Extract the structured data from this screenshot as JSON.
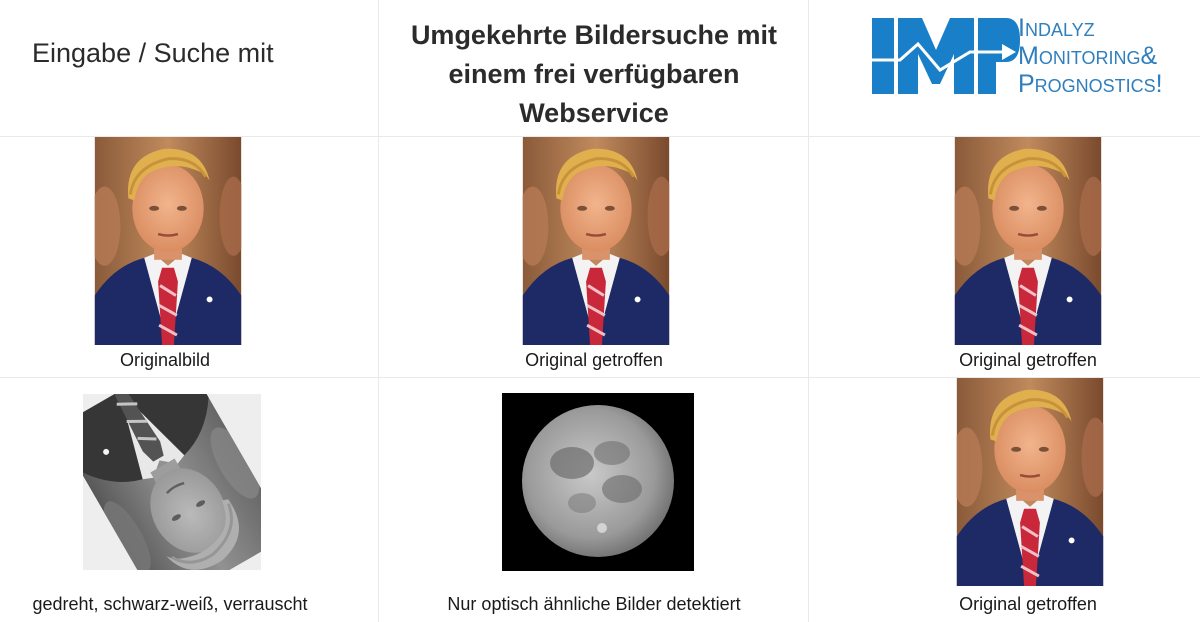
{
  "header": {
    "col1": "Eingabe / Suche mit",
    "col2_line1": "Umgekehrte Bildersuche mit",
    "col2_line2": "einem frei verfügbaren",
    "col2_line3": "Webservice"
  },
  "logo": {
    "mark": "IMP",
    "line1": "Indalyz",
    "line2": "Monitoring&",
    "line3": "Prognostics!",
    "color": "#1a7fc9"
  },
  "rows": [
    {
      "c1": "Originalbild",
      "c2": "Original getroffen",
      "c3": "Original getroffen"
    },
    {
      "c1": "gedreht, schwarz-weiß, verrauscht",
      "c2": "Nur optisch ähnliche Bilder detektiert",
      "c3": "Original getroffen"
    }
  ]
}
